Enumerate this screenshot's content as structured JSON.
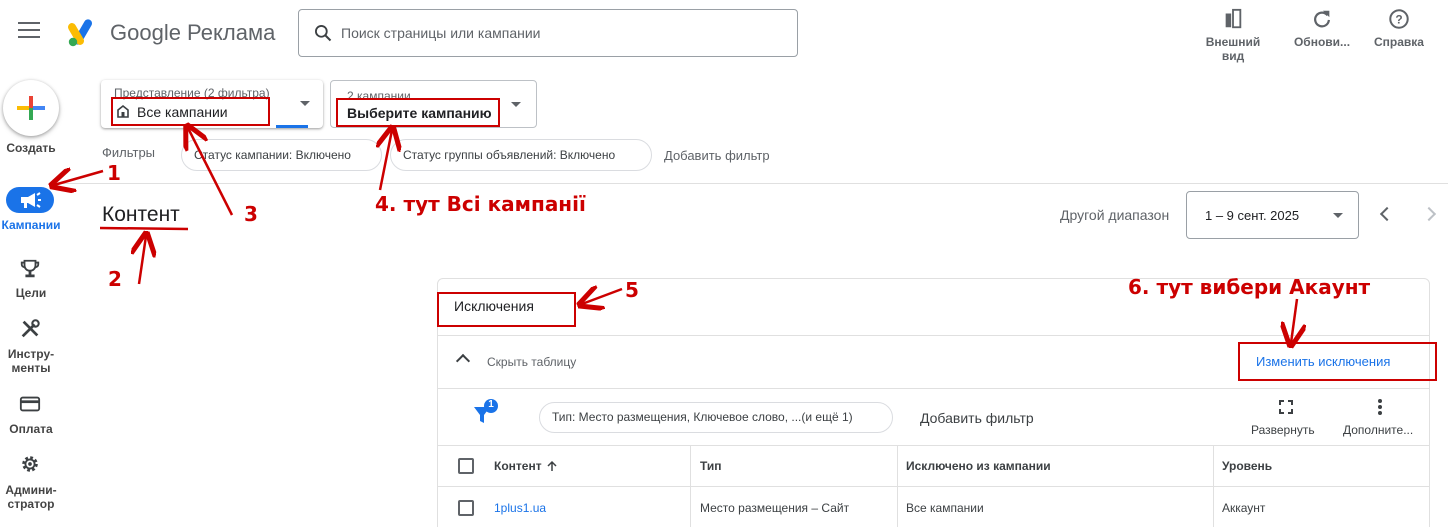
{
  "header": {
    "brand": "Google Реклама",
    "search_placeholder": "Поиск страницы или кампании",
    "tools": [
      {
        "icon": "appearance-icon",
        "label_line1": "Внешний",
        "label_line2": "вид"
      },
      {
        "icon": "refresh-icon",
        "label": "Обнови..."
      },
      {
        "icon": "help-icon",
        "label": "Справка"
      }
    ]
  },
  "rail": {
    "create": "Создать",
    "items": [
      {
        "icon": "megaphone-icon",
        "label": "Кампании",
        "active": true
      },
      {
        "icon": "trophy-icon",
        "label": "Цели"
      },
      {
        "icon": "tools-icon",
        "label_line1": "Инстру-",
        "label_line2": "менты"
      },
      {
        "icon": "credit-card-icon",
        "label": "Оплата"
      },
      {
        "icon": "gear-icon",
        "label_line1": "Админи-",
        "label_line2": "стратор"
      }
    ]
  },
  "filter_bar": {
    "view_label": "Представление (2 фильтра)",
    "view_value": "Все кампании",
    "campaigns_label": "2 кампании",
    "campaigns_value": "Выберите кампанию",
    "filters_label": "Фильтры",
    "chips": [
      "Статус кампании: Включено",
      "Статус группы объявлений: Включено"
    ],
    "add_filter": "Добавить фильтр"
  },
  "page": {
    "title": "Контент",
    "range_label": "Другой диапазон",
    "date_range": "1 – 9 сент. 2025"
  },
  "card": {
    "title": "Исключения",
    "hide_table": "Скрыть таблицу",
    "edit_link": "Изменить исключения",
    "filter_badge": "1",
    "type_chip": "Тип: Место размещения, Ключевое слово, ...(и ещё 1)",
    "add_filter": "Добавить фильтр",
    "expand": "Развернуть",
    "more": "Дополните...",
    "columns": [
      "Контент",
      "Тип",
      "Исключено из кампании",
      "Уровень"
    ],
    "rows": [
      {
        "content": "1plus1.ua",
        "type": "Место размещения – Сайт",
        "excluded_from": "Все кампании",
        "level": "Аккаунт"
      }
    ]
  },
  "annotations": {
    "n1": "1",
    "n2": "2",
    "n3": "3",
    "n4": "4. тут Всі кампанії",
    "n5": "5",
    "n6": "6. тут вибери Акаунт"
  },
  "colors": {
    "accent": "#1a73e8",
    "annotation": "#cc0000"
  }
}
